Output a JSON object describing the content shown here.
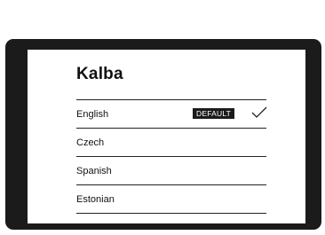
{
  "app": {
    "title": "Kalba"
  },
  "languages": [
    {
      "label": "English",
      "badge": "DEFAULT",
      "selected": true
    },
    {
      "label": "Czech"
    },
    {
      "label": "Spanish"
    },
    {
      "label": "Estonian"
    }
  ]
}
